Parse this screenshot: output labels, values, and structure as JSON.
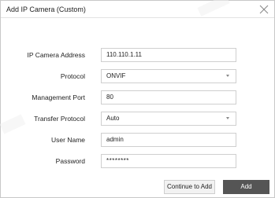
{
  "dialog": {
    "title": "Add IP Camera (Custom)",
    "close_icon": "close-icon"
  },
  "form": {
    "fields": [
      {
        "label": "IP Camera Address",
        "value": "110.110.1.11",
        "type": "text"
      },
      {
        "label": "Protocol",
        "value": "ONVIF",
        "type": "select"
      },
      {
        "label": "Management Port",
        "value": "80",
        "type": "text"
      },
      {
        "label": "Transfer Protocol",
        "value": "Auto",
        "type": "select"
      },
      {
        "label": "User Name",
        "value": "admin",
        "type": "text"
      },
      {
        "label": "Password",
        "value": "********",
        "type": "password"
      }
    ]
  },
  "buttons": {
    "continue_label": "Continue to Add",
    "add_label": "Add"
  },
  "colors": {
    "add_button_bg": "#555555",
    "border": "#cfcfcf"
  }
}
